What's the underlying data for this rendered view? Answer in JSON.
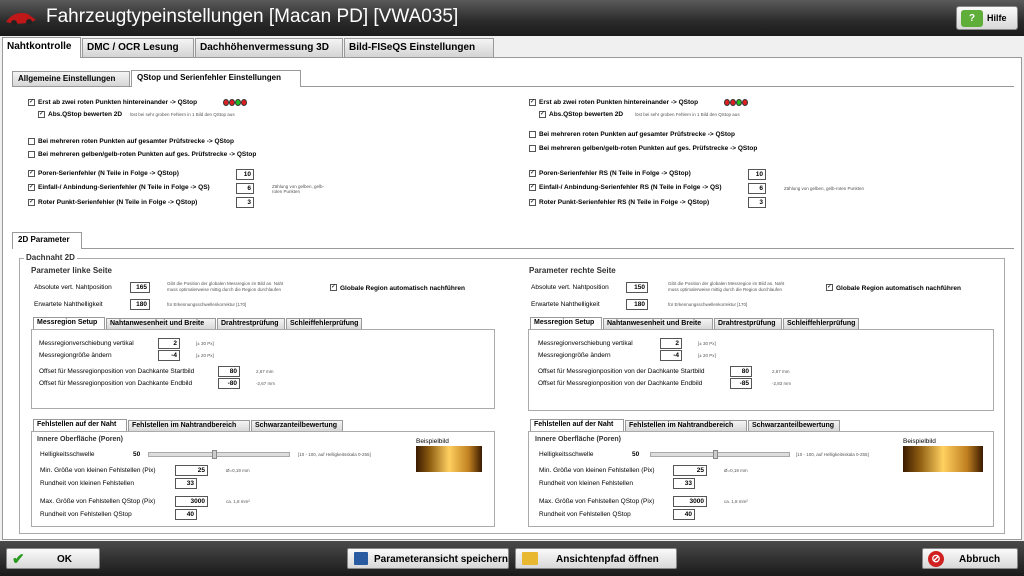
{
  "window": {
    "title": "Fahrzeugtypeinstellungen [Macan PD]  [VWA035]",
    "help": "Hilfe"
  },
  "main_tabs": [
    "Nahtkontrolle",
    "DMC / OCR Lesung",
    "Dachhöhenvermessung 3D",
    "Bild-FISeQS Einstellungen"
  ],
  "sub_tabs": [
    "Allgemeine Einstellungen",
    "QStop und Serienfehler Einstellungen"
  ],
  "qstop": {
    "left": {
      "two_red": "Erst ab zwei roten Punkten hintereinander -> QStop",
      "abs": "Abs.QStop bewerten 2D",
      "abs_note": "löst bei sehr groben Fehlern in 1 Bild den QStop aus",
      "multi_red": "Bei mehreren roten Punkten auf gesamter Prüfstrecke -> QStop",
      "multi_yellow": "Bei mehreren gelben/gelb-roten Punkten auf ges. Prüfstrecke -> QStop",
      "poren": "Poren-Serienfehler (N Teile in Folge -> QStop)",
      "poren_val": "10",
      "einfall": "Einfall-/ Anbindung-Serienfehler (N Teile in Folge -> QS)",
      "einfall_val": "6",
      "roter": "Roter Punkt-Serienfehler (N Teile in Folge -> QStop)",
      "roter_val": "3",
      "zaehlung": "Zählung von gelben, gelb-roten Punkten"
    },
    "right": {
      "two_red": "Erst ab zwei roten Punkten hintereinander -> QStop",
      "abs": "Abs.QStop bewerten 2D",
      "abs_note": "löst bei sehr groben Fehlern in 1 Bild den QStop aus",
      "multi_red": "Bei mehreren roten Punkten auf gesamter Prüfstrecke -> QStop",
      "multi_yellow": "Bei mehreren gelben/gelb-roten Punkten auf ges. Prüfstrecke -> QStop",
      "poren": "Poren-Serienfehler RS (N Teile in Folge -> QStop)",
      "poren_val": "10",
      "einfall": "Einfall-/ Anbindung-Serienfehler RS (N Teile in Folge -> QS)",
      "einfall_val": "6",
      "roter": "Roter Punkt-Serienfehler RS (N Teile in Folge -> QStop)",
      "roter_val": "3",
      "zaehlung": "Zählung von gelben, gelb-roten Punkten"
    },
    "dot_colors": [
      "#e02020",
      "#e02020",
      "#20c020",
      "#e02020"
    ]
  },
  "p2d_tab": "2D Parameter",
  "dachnaht": "Dachnaht 2D",
  "links": {
    "title": "Parameter linke Seite",
    "abs_label": "Absolute vert. Nahtposition",
    "abs_val": "165",
    "abs_note1": "Gibt die Position der globalen Messregion im Bild an. Naht",
    "abs_note2": "muss optimalerweise mittig durch die Region durchlaufen",
    "erw_label": "Erwartete Nahthelligkeit",
    "erw_val": "180",
    "erw_note": "für Erkennungsschwellenkorrektur [170]",
    "glob": "Globale Region automatisch nachführen",
    "tabs": [
      "Messregion Setup",
      "Nahtanwesenheit und Breite",
      "Drahtrestprüfung",
      "Schleiffehlerprüfung"
    ],
    "mv_label": "Messregionverschiebung vertikal",
    "mv_val": "2",
    "mv_note": "[± 30 Px]",
    "mg_label": "Messregiongröße ändern",
    "mg_val": "-4",
    "mg_note": "[± 20 Px]",
    "os_label": "Offset für Messregionposition von Dachkante Startbild",
    "os_val": "80",
    "os_note": "2,67 mm",
    "oe_label": "Offset für Messregionposition von Dachkante Endbild",
    "oe_val": "-80",
    "oe_note": "-2,67 mm",
    "ftabs": [
      "Fehlstellen auf der Naht",
      "Fehlstellen im Nahtrandbereich",
      "Schwarzanteilbewertung"
    ],
    "inner": "Innere Oberfläche (Poren)",
    "hs_label": "Helligkeitsschwelle",
    "hs_val": "50",
    "hs_note": "[10 - 100, auf Helligkeitsskala 0-255]",
    "bsp": "Beispielbild",
    "min_label": "Min. Größe von kleinen Fehlstellen (Pix)",
    "min_val": "25",
    "min_note": "Ø=0,19 mm",
    "rk_label": "Rundheit von kleinen Fehlstellen",
    "rk_val": "33",
    "max_label": "Max. Größe von Fehlstellen QStop (Pix)",
    "max_val": "3000",
    "max_note": "ca. 1,8 mm²",
    "rq_label": "Rundheit von Fehlstellen QStop",
    "rq_val": "40"
  },
  "rechts": {
    "title": "Parameter rechte Seite",
    "abs_label": "Absolute vert. Nahtposition",
    "abs_val": "150",
    "abs_note1": "Gibt die Position der globalen Messregion im Bild an. Naht",
    "abs_note2": "muss optimalerweise mittig durch die Region durchlaufen",
    "erw_label": "Erwartete Nahthelligkeit",
    "erw_val": "180",
    "erw_note": "für Erkennungsschwellenkorrektur [170]",
    "glob": "Globale Region automatisch nachführen",
    "tabs": [
      "Messregion Setup",
      "Nahtanwesenheit und Breite",
      "Drahtrestprüfung",
      "Schleiffehlerprüfung"
    ],
    "mv_label": "Messregionverschiebung vertikal",
    "mv_val": "2",
    "mv_note": "[± 30 Px]",
    "mg_label": "Messregiongröße ändern",
    "mg_val": "-4",
    "mg_note": "[± 20 Px]",
    "os_label": "Offset für Messregionposition von der Dachkante Startbild",
    "os_val": "80",
    "os_note": "2,67 mm",
    "oe_label": "Offset für Messregionposition von der Dachkante Endbild",
    "oe_val": "-85",
    "oe_note": "-2,83 mm",
    "ftabs": [
      "Fehlstellen auf der Naht",
      "Fehlstellen im Nahtrandbereich",
      "Schwarzanteilbewertung"
    ],
    "inner": "Innere Oberfläche (Poren)",
    "hs_label": "Helligkeitsschwelle",
    "hs_val": "50",
    "hs_note": "[10 - 100, auf Helligkeitsskala 0-255]",
    "bsp": "Beispielbild",
    "min_label": "Min. Größe von kleinen Fehlstellen (Pix)",
    "min_val": "25",
    "min_note": "Ø=0,19 mm",
    "rk_label": "Rundheit von kleinen Fehlstellen",
    "rk_val": "33",
    "max_label": "Max. Größe von Fehlstellen QStop (Pix)",
    "max_val": "3000",
    "max_note": "ca. 1,8 mm²",
    "rq_label": "Rundheit von Fehlstellen QStop",
    "rq_val": "40"
  },
  "buttons": {
    "ok": "OK",
    "save": "Parameteransicht speichern",
    "open": "Ansichtenpfad öffnen",
    "cancel": "Abbruch"
  }
}
